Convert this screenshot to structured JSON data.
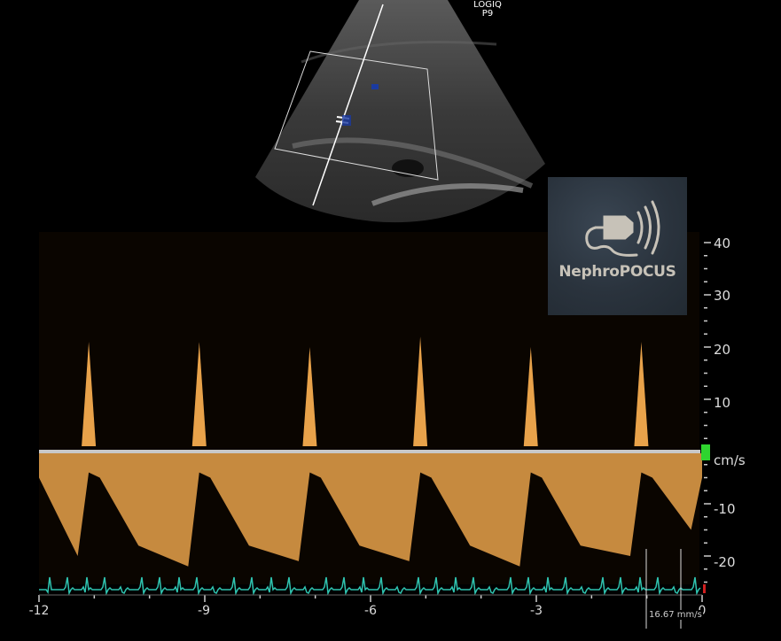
{
  "device": {
    "name": "LOGIQ",
    "model": "P9"
  },
  "logo": {
    "text": "NephroPOCUS",
    "icon": "ultrasound-probe-icon"
  },
  "velocity_axis": {
    "unit": "cm/s",
    "ticks": [
      "40",
      "30",
      "20",
      "10",
      "-10",
      "-20"
    ]
  },
  "time_axis": {
    "ticks": [
      "-12",
      "-9",
      "-6",
      "-3",
      "0"
    ]
  },
  "sweep_speed": "16.67 mm/s",
  "colors": {
    "background": "#000000",
    "doppler": "#e8a24a",
    "baseline": "#c8c8c8",
    "ecg": "#2fc4b0",
    "marker": "#2fd52f"
  },
  "chart_data": {
    "type": "area",
    "x": [
      -12,
      -11.3,
      -11.1,
      -10.9,
      -10.2,
      -9.3,
      -9.1,
      -8.9,
      -8.2,
      -7.3,
      -7.1,
      -6.9,
      -6.2,
      -5.3,
      -5.1,
      -4.9,
      -4.2,
      -3.3,
      -3.1,
      -2.9,
      -2.2,
      -1.3,
      -1.1,
      -0.9,
      -0.2,
      0
    ],
    "series": [
      {
        "values": [
          -5,
          -20,
          21,
          -5,
          -18,
          -22,
          21,
          -5,
          -18,
          -21,
          20,
          -5,
          -18,
          -21,
          22,
          -5,
          -18,
          -22,
          20,
          -5,
          -18,
          -20,
          21,
          -5,
          -15,
          -5
        ]
      }
    ],
    "xlim": [
      -12,
      0
    ],
    "ylim": [
      -25,
      42
    ],
    "grid": false
  }
}
